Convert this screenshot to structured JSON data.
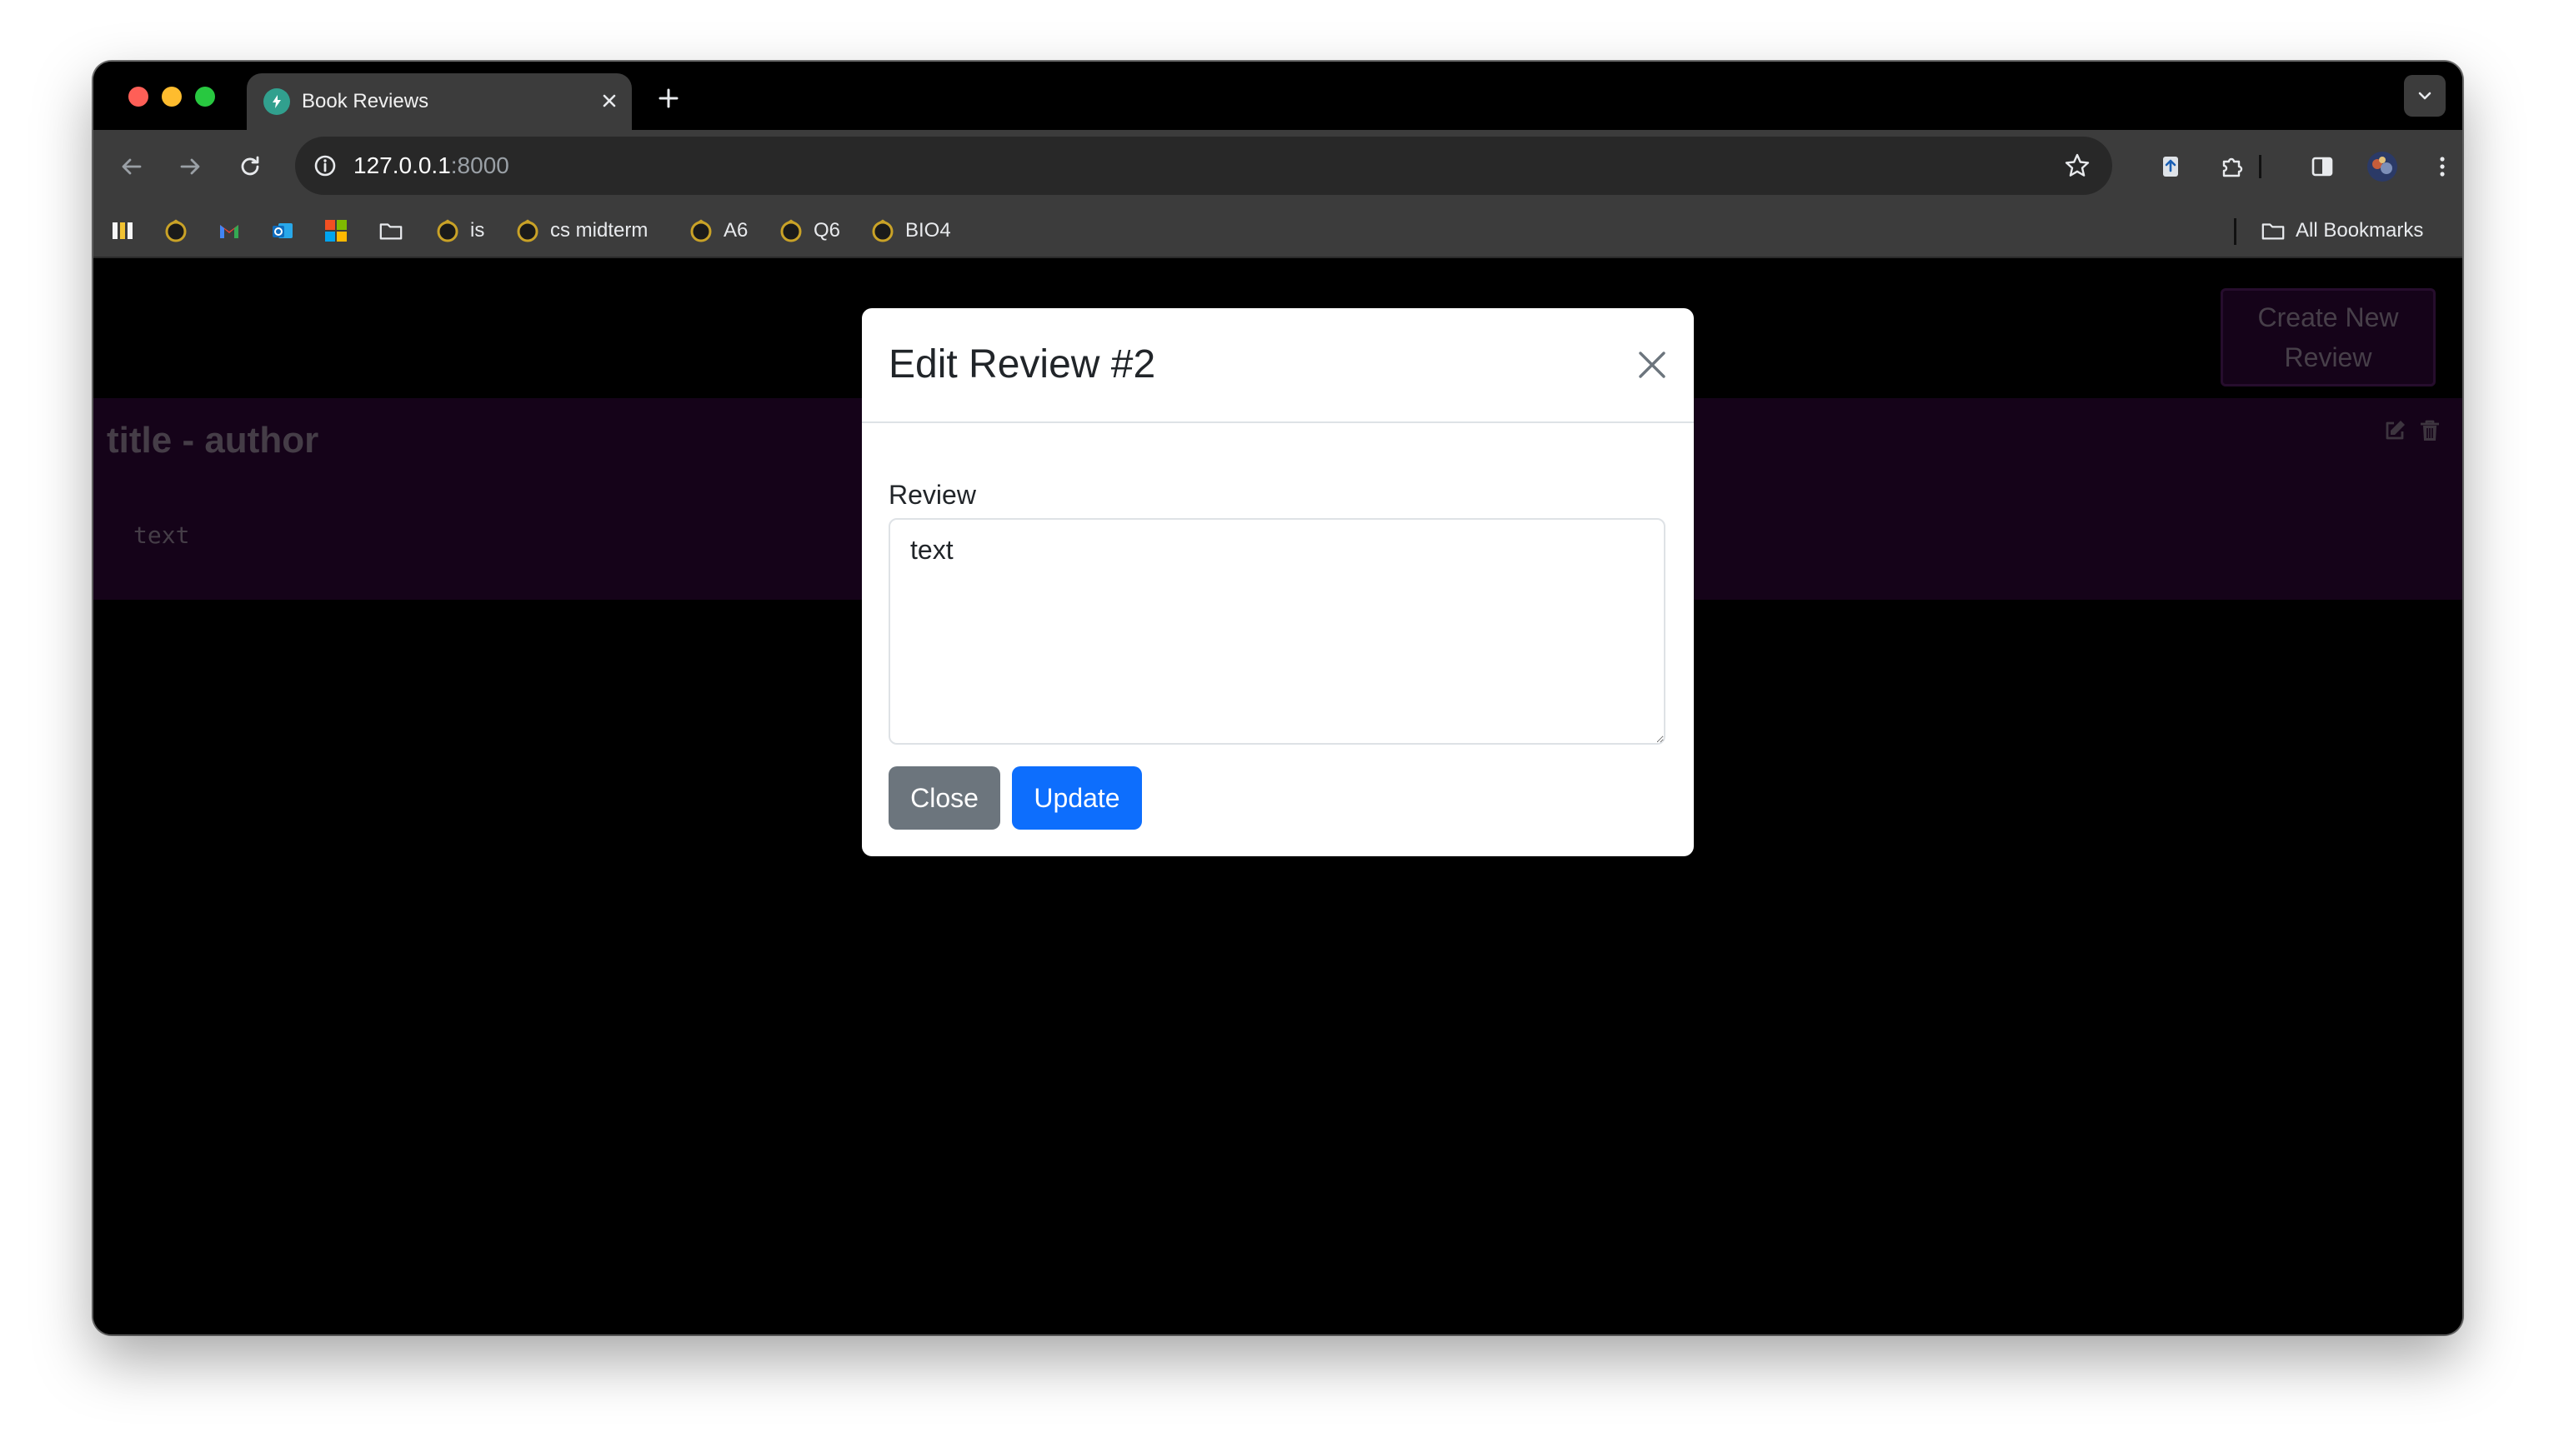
{
  "browser": {
    "tab": {
      "title": "Book Reviews"
    },
    "address": {
      "host": "127.0.0.1",
      "port": ":8000"
    },
    "bookmarks": [
      {
        "label": "",
        "icon": "bars-logo-icon"
      },
      {
        "label": "",
        "icon": "bookmark-globe-icon"
      },
      {
        "label": "",
        "icon": "gmail-icon"
      },
      {
        "label": "",
        "icon": "outlook-icon"
      },
      {
        "label": "",
        "icon": "microsoft-icon"
      },
      {
        "label": "",
        "icon": "folder-icon"
      },
      {
        "label": "is",
        "icon": "bookmark-globe-icon"
      },
      {
        "label": "cs midterm",
        "icon": "bookmark-globe-icon"
      },
      {
        "label": "A6",
        "icon": "bookmark-globe-icon"
      },
      {
        "label": "Q6",
        "icon": "bookmark-globe-icon"
      },
      {
        "label": "BIO4",
        "icon": "bookmark-globe-icon"
      }
    ],
    "all_bookmarks_label": "All Bookmarks"
  },
  "page": {
    "create_button_label": "Create New Review",
    "review": {
      "title": "title - author",
      "text": "text"
    }
  },
  "modal": {
    "title": "Edit Review #2",
    "field_label": "Review",
    "field_value": "text",
    "close_label": "Close",
    "update_label": "Update"
  },
  "colors": {
    "accent_purple": "#2a0633",
    "primary_blue": "#0d6efd",
    "secondary_gray": "#6c757d"
  }
}
